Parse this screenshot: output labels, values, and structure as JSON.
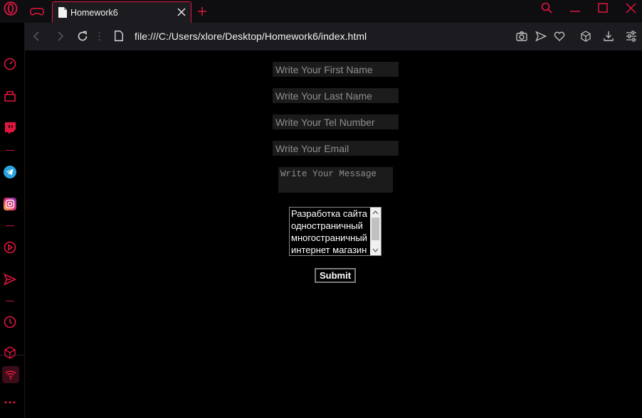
{
  "browser": {
    "tab_title": "Homework6",
    "url": "file:///C:/Users/xlore/Desktop/Homework6/index.html",
    "accent": "#e0163f"
  },
  "icons": {
    "titlebar": [
      "opera-gx-logo",
      "gx-control-gamepad",
      "file-icon",
      "close-icon",
      "plus-icon",
      "search-icon",
      "minimize-icon",
      "maximize-icon",
      "close-icon"
    ],
    "addressbar": [
      "back-icon",
      "forward-icon",
      "reload-icon",
      "page-icon",
      "camera-icon",
      "send-icon",
      "heart-icon",
      "cube-icon",
      "download-icon",
      "settings-sliders-icon"
    ],
    "sidebar": [
      "speed-dial-icon",
      "gx-corner-icon",
      "twitch-icon",
      "telegram-icon",
      "instagram-icon",
      "player-icon",
      "send-icon",
      "history-icon",
      "extensions-icon",
      "network-limiter-icon",
      "more-icon"
    ]
  },
  "form": {
    "first_name_placeholder": "Write Your First Name",
    "last_name_placeholder": "Write Your Last Name",
    "tel_placeholder": "Write Your Tel Number",
    "email_placeholder": "Write Your Email",
    "message_placeholder": "Write Your Message",
    "list_options": [
      "Разработка сайта",
      "одностраничный",
      "многостраничный",
      "интернет магазин"
    ],
    "submit_label": "Submit"
  }
}
